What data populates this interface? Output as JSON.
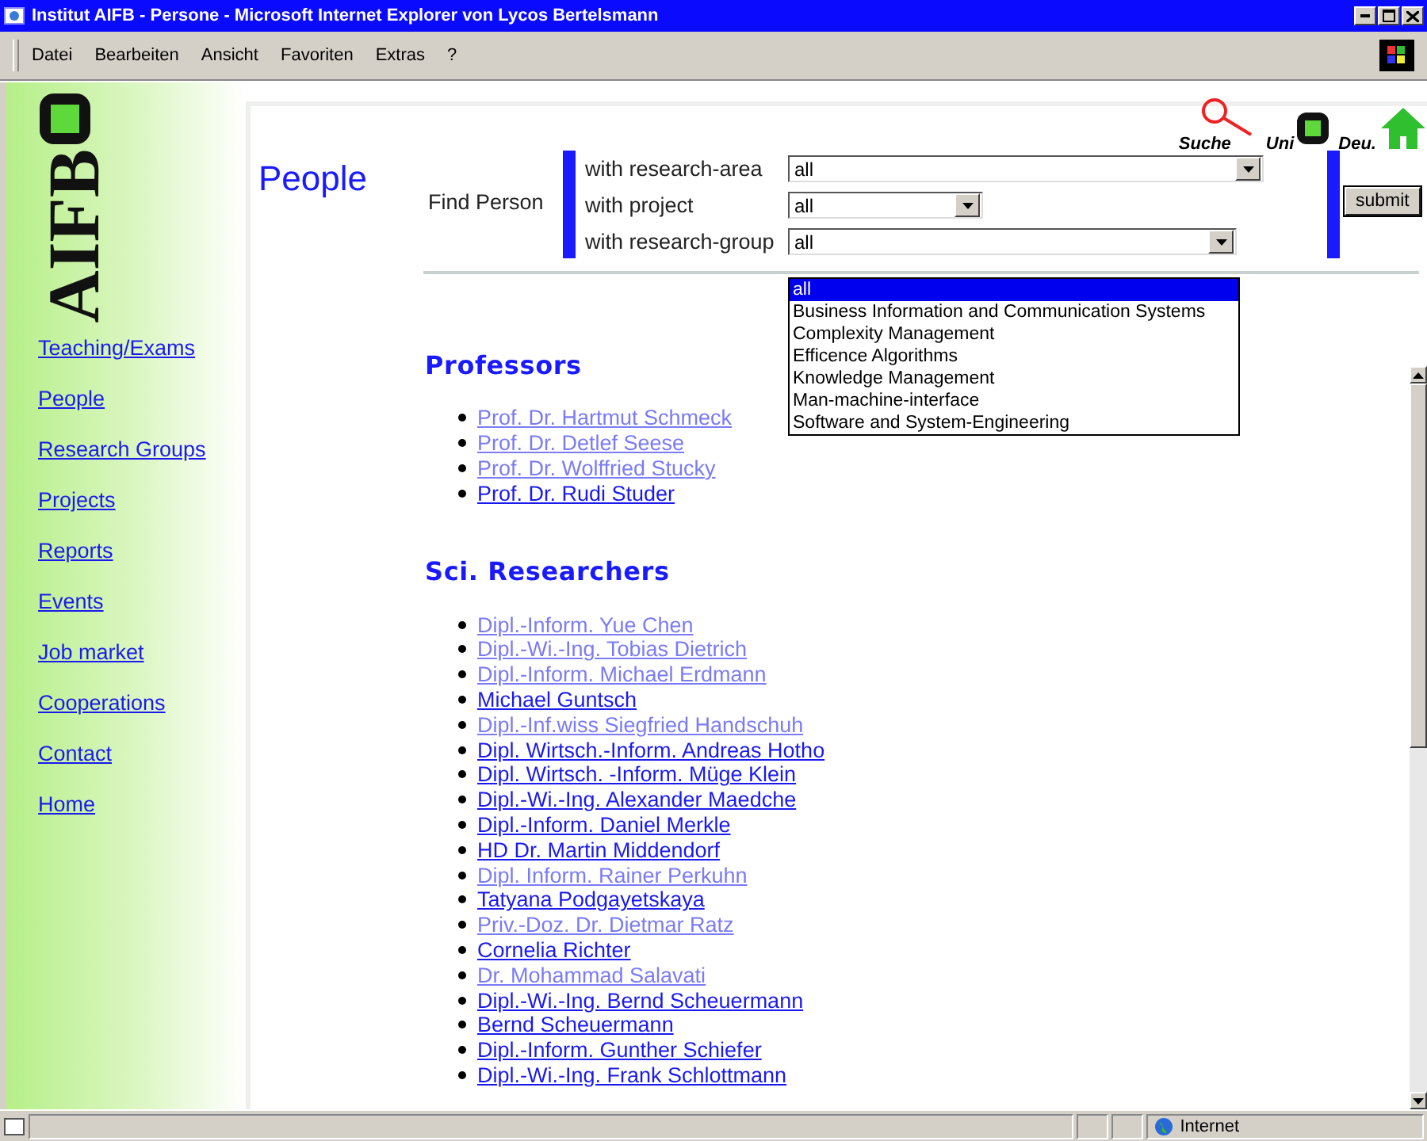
{
  "window": {
    "title": "Institut AIFB - Persone - Microsoft Internet Explorer von Lycos Bertelsmann"
  },
  "menu": [
    "Datei",
    "Bearbeiten",
    "Ansicht",
    "Favoriten",
    "Extras",
    "?"
  ],
  "sidebar": {
    "logo": "AIFB",
    "items": [
      "Teaching/Exams",
      "People",
      "Research Groups",
      "Projects",
      "Reports",
      "Events",
      "Job market",
      "Cooperations",
      "Contact",
      "Home"
    ]
  },
  "top_links": [
    "Suche",
    "Uni",
    "Deu."
  ],
  "page_title": "People",
  "search": {
    "label": "Find Person",
    "filters": [
      {
        "label": "with research-area",
        "value": "all"
      },
      {
        "label": "with project",
        "value": "all"
      },
      {
        "label": "with research-group",
        "value": "all",
        "options": [
          {
            "label": "all",
            "selected": true
          },
          {
            "label": "Business Information and Communication Systems",
            "selected": false
          },
          {
            "label": "Complexity Management",
            "selected": false
          },
          {
            "label": "Efficence Algorithms",
            "selected": false
          },
          {
            "label": "Knowledge Management",
            "selected": false
          },
          {
            "label": "Man-machine-interface",
            "selected": false
          },
          {
            "label": "Software and System-Engineering",
            "selected": false
          }
        ]
      }
    ],
    "submit": "submit"
  },
  "sections": [
    {
      "heading": "Professors",
      "people": [
        {
          "name": "Prof. Dr. Hartmut Schmeck",
          "visited": true
        },
        {
          "name": "Prof. Dr. Detlef Seese",
          "visited": true
        },
        {
          "name": "Prof. Dr. Wolffried Stucky",
          "visited": true
        },
        {
          "name": "Prof. Dr. Rudi Studer",
          "visited": false
        }
      ]
    },
    {
      "heading": "Sci. Researchers",
      "people": [
        {
          "name": "Dipl.-Inform. Yue Chen",
          "visited": true
        },
        {
          "name": "Dipl.-Wi.-Ing. Tobias Dietrich",
          "visited": true
        },
        {
          "name": "Dipl.-Inform. Michael Erdmann",
          "visited": true
        },
        {
          "name": "Michael Guntsch",
          "visited": false
        },
        {
          "name": "Dipl.-Inf.wiss Siegfried Handschuh",
          "visited": true
        },
        {
          "name": "Dipl. Wirtsch.-Inform. Andreas Hotho",
          "visited": false
        },
        {
          "name": "Dipl. Wirtsch. -Inform. Müge Klein",
          "visited": false
        },
        {
          "name": "Dipl.-Wi.-Ing. Alexander Maedche",
          "visited": false
        },
        {
          "name": "Dipl.-Inform. Daniel Merkle",
          "visited": false
        },
        {
          "name": "HD Dr. Martin Middendorf",
          "visited": false
        },
        {
          "name": "Dipl. Inform. Rainer Perkuhn",
          "visited": true
        },
        {
          "name": "Tatyana Podgayetskaya",
          "visited": false
        },
        {
          "name": "Priv.-Doz. Dr. Dietmar Ratz",
          "visited": true
        },
        {
          "name": "Cornelia Richter",
          "visited": false
        },
        {
          "name": "Dr. Mohammad Salavati",
          "visited": true
        },
        {
          "name": "Dipl.-Wi.-Ing. Bernd Scheuermann",
          "visited": false
        },
        {
          "name": "Bernd Scheuermann",
          "visited": false
        },
        {
          "name": "Dipl.-Inform. Gunther Schiefer",
          "visited": false
        },
        {
          "name": "Dipl.-Wi.-Ing. Frank Schlottmann",
          "visited": false
        }
      ]
    }
  ],
  "status_bar": {
    "zone": "Internet"
  }
}
